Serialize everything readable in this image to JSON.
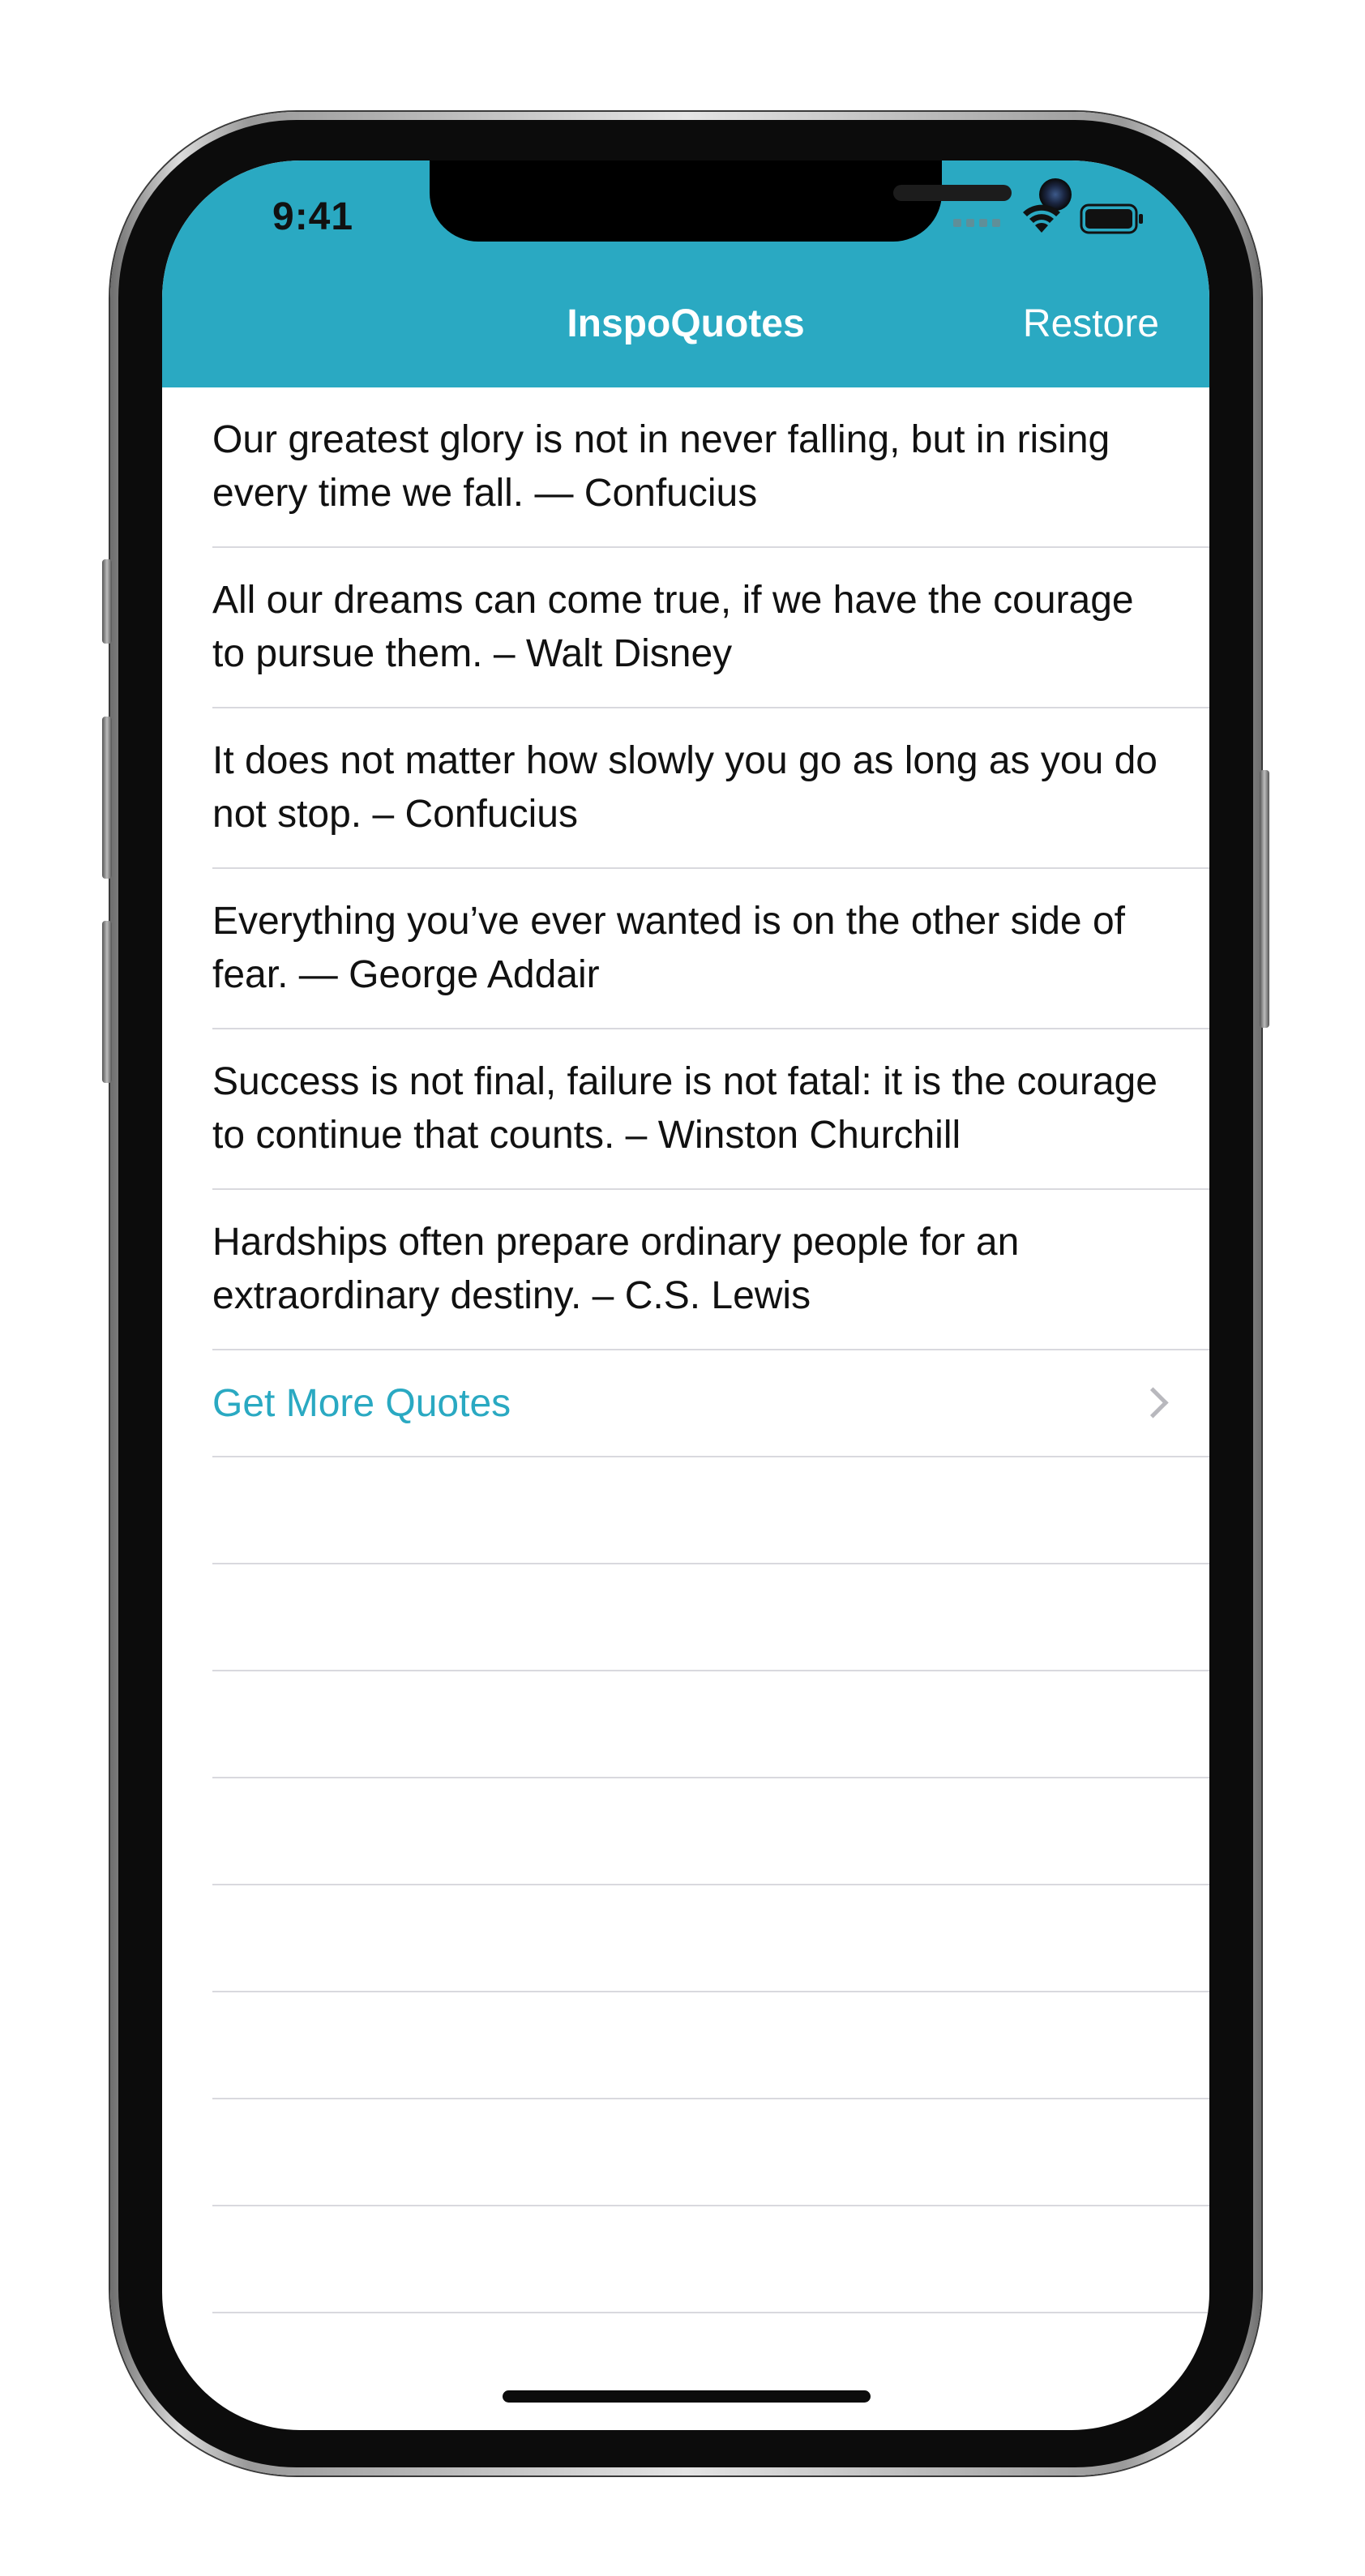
{
  "status_bar": {
    "time": "9:41"
  },
  "nav": {
    "title": "InspoQuotes",
    "restore_label": "Restore",
    "bar_color": "#2aa9c2"
  },
  "quotes": [
    "Our greatest glory is not in never falling, but in rising every time we fall. — Confucius",
    "All our dreams can come true, if we have the courage to pursue them. – Walt Disney",
    "It does not matter how slowly you go as long as you do not stop. – Confucius",
    "Everything you’ve ever wanted is on the other side of fear. — George Addair",
    "Success is not final, failure is not fatal: it is the courage to continue that counts. – Winston Churchill",
    "Hardships often prepare ordinary people for an extraordinary destiny. – C.S. Lewis"
  ],
  "more_row": {
    "label": "Get More Quotes",
    "icon": "chevron-right-icon",
    "color": "#2aa9c2"
  }
}
